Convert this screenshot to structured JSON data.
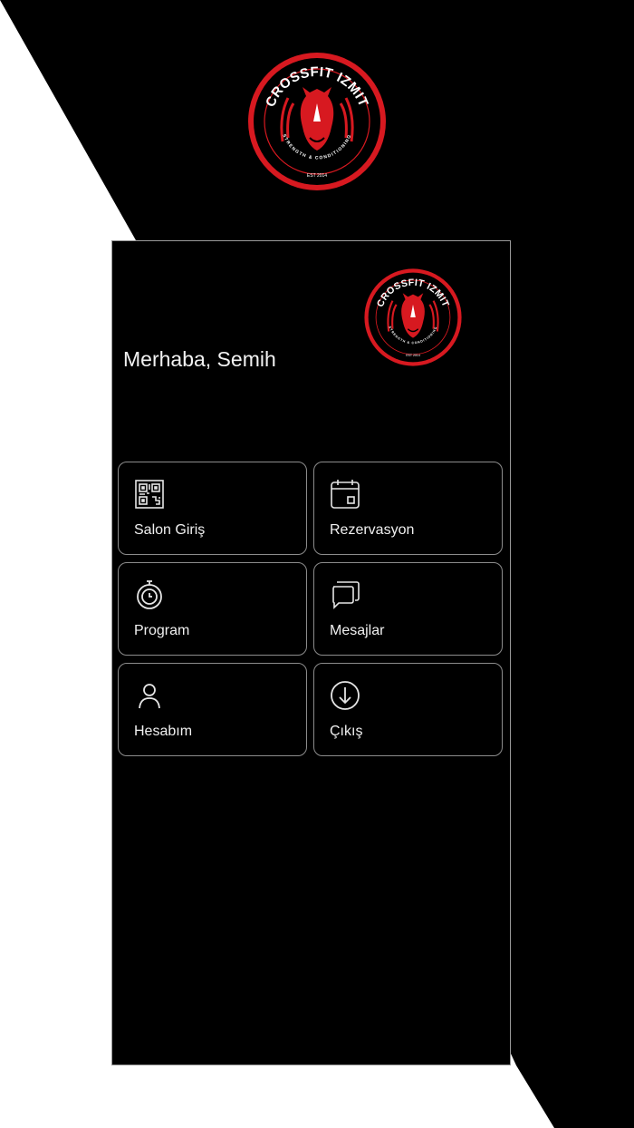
{
  "brand": {
    "name_left": "CROSSFIT",
    "name_right": "IZMIT",
    "tagline": "STRENGTH & CONDITIONING",
    "est": "EST 2014",
    "accent_color": "#d71920"
  },
  "home": {
    "greeting": "Merhaba, Semih"
  },
  "menu": [
    {
      "label": "Salon Giriş",
      "icon": "qr-code-icon"
    },
    {
      "label": "Rezervasyon",
      "icon": "calendar-icon"
    },
    {
      "label": "Program",
      "icon": "stopwatch-icon"
    },
    {
      "label": "Mesajlar",
      "icon": "chat-bubbles-icon"
    },
    {
      "label": "Hesabım",
      "icon": "user-icon"
    },
    {
      "label": "Çıkış",
      "icon": "logout-icon"
    }
  ]
}
